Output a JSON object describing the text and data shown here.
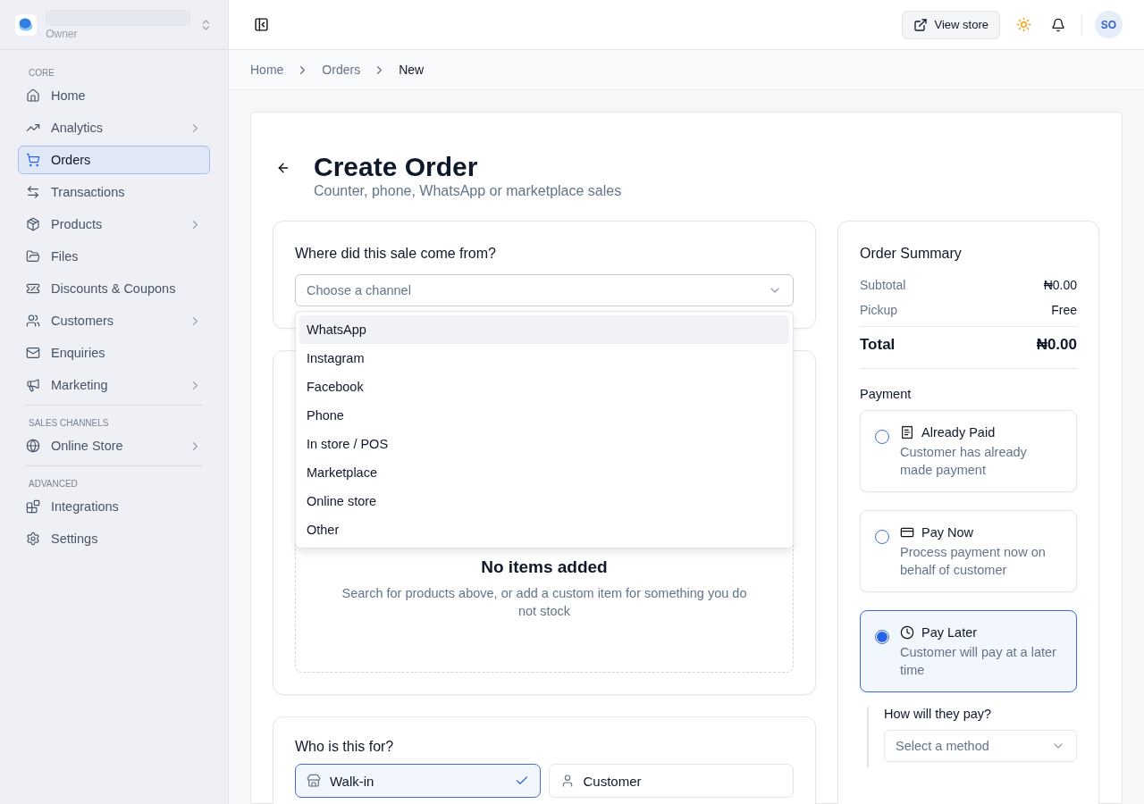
{
  "workspace": {
    "role": "Owner"
  },
  "sidebar": {
    "sections": [
      {
        "heading": "CORE",
        "items": [
          {
            "label": "Home",
            "has_submenu": false,
            "selected": false
          },
          {
            "label": "Analytics",
            "has_submenu": true,
            "selected": false
          },
          {
            "label": "Orders",
            "has_submenu": false,
            "selected": true
          },
          {
            "label": "Transactions",
            "has_submenu": false,
            "selected": false
          },
          {
            "label": "Products",
            "has_submenu": true,
            "selected": false
          },
          {
            "label": "Files",
            "has_submenu": false,
            "selected": false
          },
          {
            "label": "Discounts & Coupons",
            "has_submenu": false,
            "selected": false
          },
          {
            "label": "Customers",
            "has_submenu": true,
            "selected": false
          },
          {
            "label": "Enquiries",
            "has_submenu": false,
            "selected": false
          },
          {
            "label": "Marketing",
            "has_submenu": true,
            "selected": false
          }
        ]
      },
      {
        "heading": "SALES CHANNELS",
        "items": [
          {
            "label": "Online Store",
            "has_submenu": true,
            "selected": false
          }
        ]
      },
      {
        "heading": "ADVANCED",
        "items": [
          {
            "label": "Integrations",
            "has_submenu": false,
            "selected": false
          },
          {
            "label": "Settings",
            "has_submenu": false,
            "selected": false
          }
        ]
      }
    ]
  },
  "topbar": {
    "view_store": "View store",
    "avatar": "SO"
  },
  "breadcrumb": [
    "Home",
    "Orders",
    "New"
  ],
  "page": {
    "title": "Create Order",
    "subtitle": "Counter, phone, WhatsApp or marketplace sales"
  },
  "channel": {
    "question": "Where did this sale come from?",
    "placeholder": "Choose a channel",
    "expanded": true,
    "options": [
      {
        "label": "WhatsApp",
        "highlighted": true
      },
      {
        "label": "Instagram",
        "highlighted": false
      },
      {
        "label": "Facebook",
        "highlighted": false
      },
      {
        "label": "Phone",
        "highlighted": false
      },
      {
        "label": "In store / POS",
        "highlighted": false
      },
      {
        "label": "Marketplace",
        "highlighted": false
      },
      {
        "label": "Online store",
        "highlighted": false
      },
      {
        "label": "Other",
        "highlighted": false
      }
    ]
  },
  "items_panel": {
    "empty_title": "No items added",
    "empty_text": "Search for products above, or add a custom item for something you do not stock"
  },
  "recipient": {
    "question": "Who is this for?",
    "options": [
      {
        "label": "Walk-in",
        "selected": true
      },
      {
        "label": "Customer",
        "selected": false
      }
    ]
  },
  "summary": {
    "title": "Order Summary",
    "lines": [
      {
        "label": "Subtotal",
        "value": "₦0.00"
      },
      {
        "label": "Pickup",
        "value": "Free"
      }
    ],
    "total": {
      "label": "Total",
      "value": "₦0.00"
    },
    "payment_heading": "Payment",
    "payment_options": [
      {
        "title": "Already Paid",
        "description": "Customer has already made payment",
        "selected": false
      },
      {
        "title": "Pay Now",
        "description": "Process payment now on behalf of customer",
        "selected": false
      },
      {
        "title": "Pay Later",
        "description": "Customer will pay at a later time",
        "selected": true
      }
    ],
    "method": {
      "question": "How will they pay?",
      "placeholder": "Select a method"
    }
  }
}
